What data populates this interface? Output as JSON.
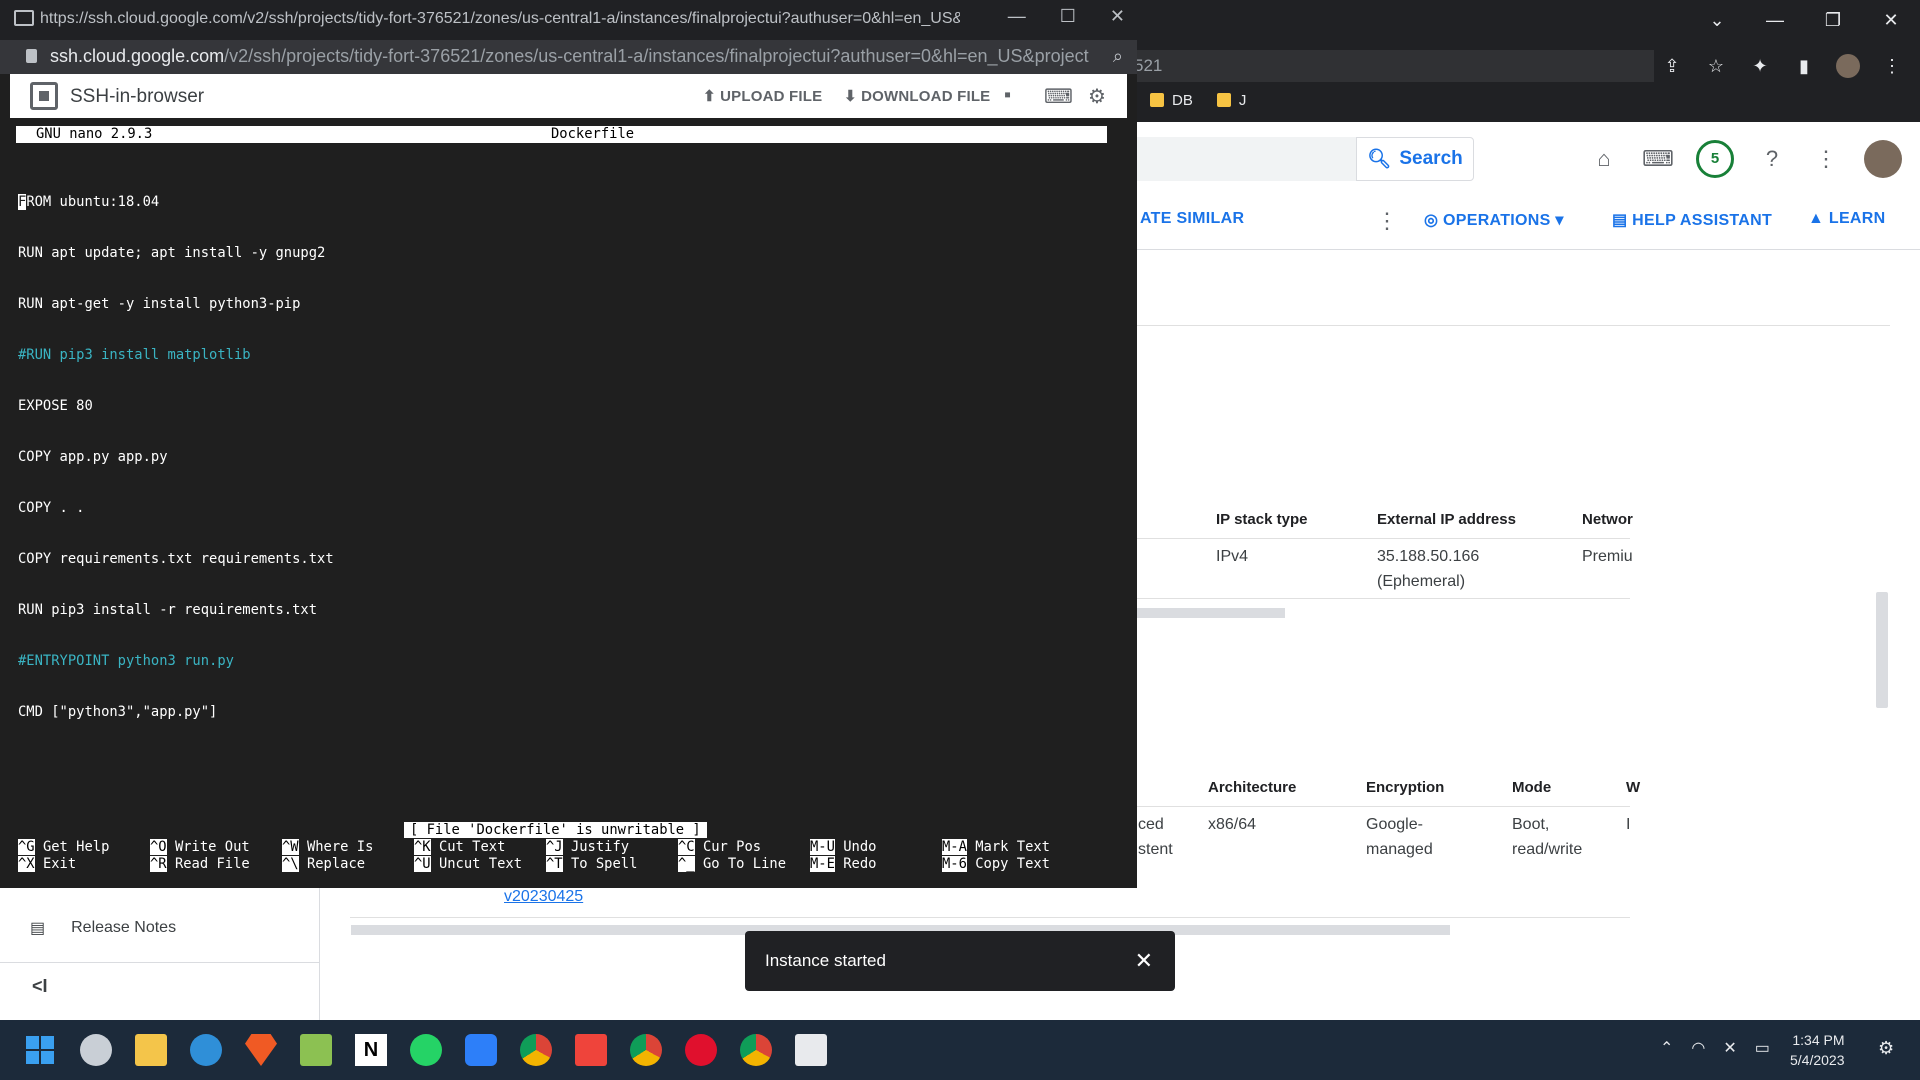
{
  "background": {
    "omnibox_partial": "521",
    "bookmarks": [
      "DB",
      "J"
    ],
    "search_button": "Search",
    "notifications_count": "5",
    "actions": {
      "create_similar": "ATE SIMILAR",
      "operations": "OPERATIONS",
      "help_assistant": "HELP ASSISTANT",
      "learn": "LEARN"
    },
    "network_table": {
      "headers": [
        "IP stack type",
        "External IP address",
        "Networ"
      ],
      "row": [
        "IPv4",
        "35.188.50.166",
        "(Ephemeral)",
        "Premiu"
      ]
    },
    "disk_table": {
      "headers": [
        "Architecture",
        "Encryption",
        "Mode",
        "W"
      ],
      "row_partial": [
        "ced",
        "stent"
      ],
      "row": [
        "x86/64",
        "Google-",
        "managed",
        "Boot,",
        "read/write",
        "I"
      ]
    },
    "version_link": "v20230425",
    "sidebar": {
      "release_notes": "Release Notes",
      "collapse": "<I"
    }
  },
  "snackbar": {
    "message": "Instance started"
  },
  "ssh_window": {
    "title_url": "https://ssh.cloud.google.com/v2/ssh/projects/tidy-fort-376521/zones/us-central1-a/instances/finalprojectui?authuser=0&hl=en_US&proj...",
    "url_host": "ssh.cloud.google.com",
    "url_path": "/v2/ssh/projects/tidy-fort-376521/zones/us-central1-a/instances/finalprojectui?authuser=0&hl=en_US&project...",
    "app_title": "SSH-in-browser",
    "upload_file": "UPLOAD FILE",
    "download_file": "DOWNLOAD FILE"
  },
  "nano": {
    "version": "GNU nano 2.9.3",
    "filename": "Dockerfile",
    "first_char": "F",
    "lines": [
      {
        "text": "ROM ubuntu:18.04",
        "comment": false
      },
      {
        "text": "RUN apt update; apt install -y gnupg2",
        "comment": false
      },
      {
        "text": "RUN apt-get -y install python3-pip",
        "comment": false
      },
      {
        "text": "#RUN pip3 install matplotlib",
        "comment": true
      },
      {
        "text": "EXPOSE 80",
        "comment": false
      },
      {
        "text": "COPY app.py app.py",
        "comment": false
      },
      {
        "text": "COPY . .",
        "comment": false
      },
      {
        "text": "COPY requirements.txt requirements.txt",
        "comment": false
      },
      {
        "text": "RUN pip3 install -r requirements.txt",
        "comment": false
      },
      {
        "text": "#ENTRYPOINT python3 run.py",
        "comment": true
      },
      {
        "text": "CMD [\"python3\",\"app.py\"]",
        "comment": false
      }
    ],
    "status": "[ File 'Dockerfile' is unwritable ]",
    "shortcuts": [
      {
        "key": "^G",
        "label": "Get Help"
      },
      {
        "key": "^X",
        "label": "Exit"
      },
      {
        "key": "^O",
        "label": "Write Out"
      },
      {
        "key": "^R",
        "label": "Read File"
      },
      {
        "key": "^W",
        "label": "Where Is"
      },
      {
        "key": "^\\",
        "label": "Replace"
      },
      {
        "key": "^K",
        "label": "Cut Text"
      },
      {
        "key": "^U",
        "label": "Uncut Text"
      },
      {
        "key": "^J",
        "label": "Justify"
      },
      {
        "key": "^T",
        "label": "To Spell"
      },
      {
        "key": "^C",
        "label": "Cur Pos"
      },
      {
        "key": "^_",
        "label": "Go To Line"
      },
      {
        "key": "M-U",
        "label": "Undo"
      },
      {
        "key": "M-E",
        "label": "Redo"
      },
      {
        "key": "M-A",
        "label": "Mark Text"
      },
      {
        "key": "M-6",
        "label": "Copy Text"
      }
    ]
  },
  "taskbar": {
    "time": "1:34 PM",
    "date": "5/4/2023"
  },
  "colors": {
    "accent": "#1a73e8",
    "terminal_bg": "#1f1f1f",
    "comment": "#3ab4c3",
    "taskbar_bg": "#1c2a3a"
  }
}
